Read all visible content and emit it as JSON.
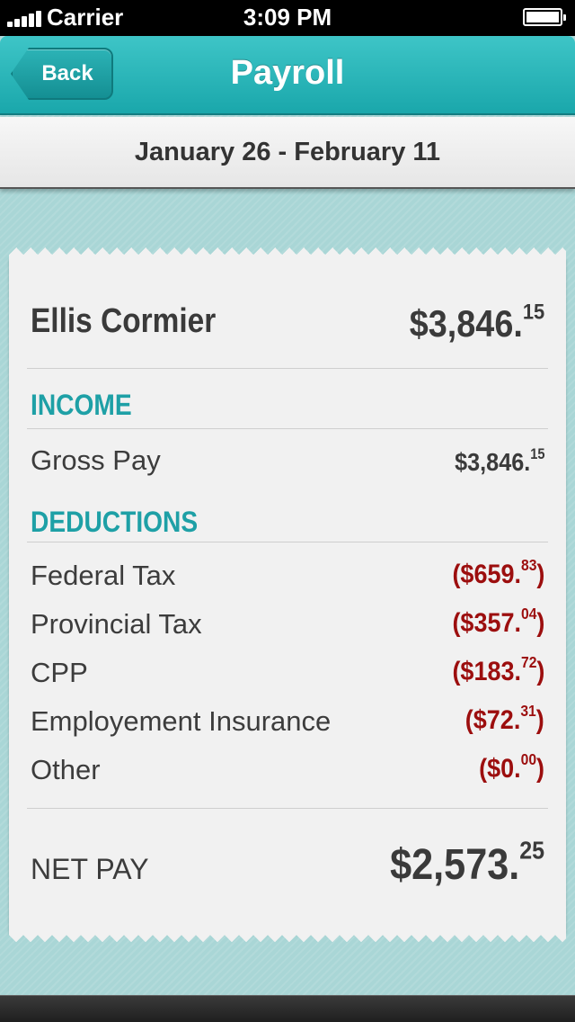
{
  "status_bar": {
    "carrier": "Carrier",
    "time": "3:09 PM"
  },
  "nav": {
    "back_label": "Back",
    "title": "Payroll"
  },
  "period": {
    "label": "January 26 - February 11"
  },
  "employee": {
    "name": "Ellis Cormier",
    "total": {
      "whole": "$3,846.",
      "cents": "15"
    }
  },
  "income": {
    "header": "INCOME",
    "items": [
      {
        "label": "Gross Pay",
        "whole": "$3,846.",
        "cents": "15"
      }
    ]
  },
  "deductions": {
    "header": "DEDUCTIONS",
    "items": [
      {
        "label": "Federal Tax",
        "whole": "($659.",
        "cents": "83",
        "close": ")"
      },
      {
        "label": "Provincial Tax",
        "whole": "($357.",
        "cents": "04",
        "close": ")"
      },
      {
        "label": "CPP",
        "whole": "($183.",
        "cents": "72",
        "close": ")"
      },
      {
        "label": "Employement Insurance",
        "whole": "($72.",
        "cents": "31",
        "close": ")"
      },
      {
        "label": "Other",
        "whole": "($0.",
        "cents": "00",
        "close": ")"
      }
    ]
  },
  "net_pay": {
    "label": "NET PAY",
    "whole": "$2,573.",
    "cents": "25"
  },
  "colors": {
    "accent": "#1ea0a6",
    "deduction": "#9c0e0e",
    "nav": "#1aa7ab"
  }
}
